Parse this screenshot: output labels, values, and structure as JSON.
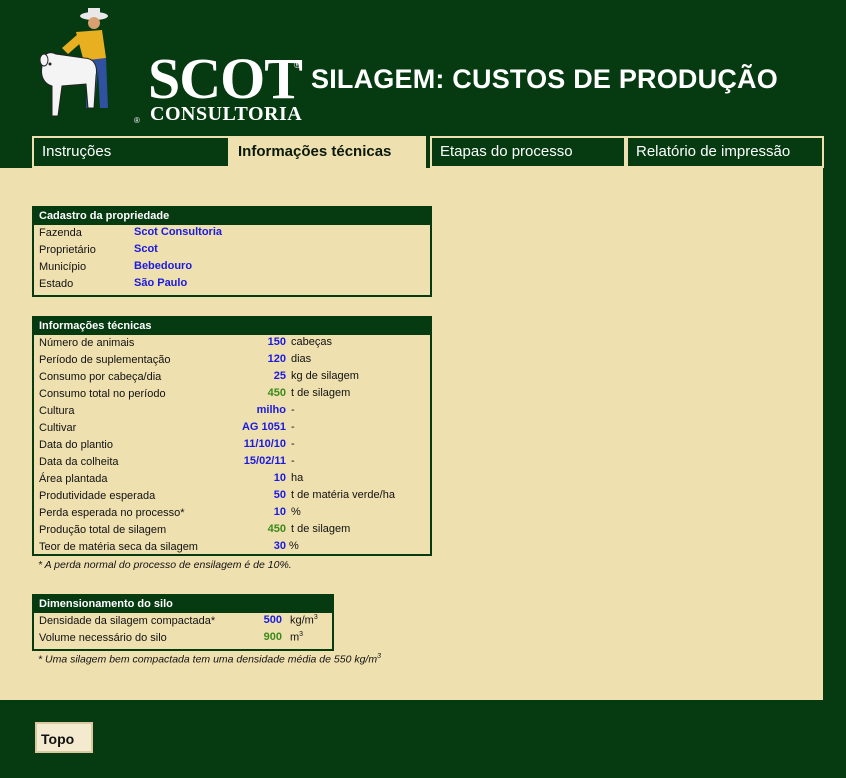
{
  "header": {
    "logo_word": "SCOT",
    "logo_sub": "CONSULTORIA",
    "logo_reg": "®",
    "title": "SILAGEM: CUSTOS DE PRODUÇÃO"
  },
  "tabs": [
    {
      "label": "Instruções",
      "active": false
    },
    {
      "label": "Informações técnicas",
      "active": true
    },
    {
      "label": "Etapas do processo",
      "active": false
    },
    {
      "label": "Relatório de impressão",
      "active": false
    }
  ],
  "cadastro": {
    "title": "Cadastro da propriedade",
    "rows": [
      {
        "label": "Fazenda",
        "value": "Scot Consultoria"
      },
      {
        "label": "Proprietário",
        "value": "Scot"
      },
      {
        "label": "Município",
        "value": "Bebedouro"
      },
      {
        "label": "Estado",
        "value": "São Paulo"
      }
    ]
  },
  "info": {
    "title": "Informações técnicas",
    "rows": [
      {
        "label": "Número de animais",
        "value": "150",
        "unit": "cabeças",
        "color": "blue"
      },
      {
        "label": "Período de suplementação",
        "value": "120",
        "unit": "dias",
        "color": "blue"
      },
      {
        "label": "Consumo por cabeça/dia",
        "value": "25",
        "unit": "kg de silagem",
        "color": "blue"
      },
      {
        "label": "Consumo total no período",
        "value": "450",
        "unit": "t de silagem",
        "color": "green"
      },
      {
        "label": "Cultura",
        "value": "milho",
        "unit": "-",
        "color": "blue"
      },
      {
        "label": "Cultivar",
        "value": "AG 1051",
        "unit": "-",
        "color": "blue"
      },
      {
        "label": "Data do plantio",
        "value": "11/10/10",
        "unit": "-",
        "color": "blue"
      },
      {
        "label": "Data da colheita",
        "value": "15/02/11",
        "unit": "-",
        "color": "blue"
      },
      {
        "label": "Área plantada",
        "value": "10",
        "unit": "ha",
        "color": "blue"
      },
      {
        "label": "Produtividade esperada",
        "value": "50",
        "unit": "t de matéria verde/ha",
        "color": "blue"
      },
      {
        "label": "Perda esperada no processo*",
        "value": "10",
        "unit": "%",
        "color": "blue"
      },
      {
        "label": "Produção total de silagem",
        "value": "450",
        "unit": "t de silagem",
        "color": "green"
      },
      {
        "label": "Teor de matéria seca da silagem",
        "value": "30",
        "unit": "%",
        "color": "blue"
      }
    ],
    "note": "* A perda normal do processo de ensilagem é de 10%."
  },
  "silo": {
    "title": "Dimensionamento do silo",
    "rows": [
      {
        "label": "Densidade da silagem compactada*",
        "value": "500",
        "unit": "kg/m",
        "sup": "3",
        "color": "blue"
      },
      {
        "label": "Volume necessário do silo",
        "value": "900",
        "unit": "m",
        "sup": "3",
        "color": "green"
      }
    ],
    "note": "* Uma silagem bem compactada tem uma densidade média de 550 kg/m",
    "note_sup": "3"
  },
  "footer": {
    "top_button": "Topo"
  },
  "colors": {
    "dark_green": "#063b12",
    "beige": "#efe0b0",
    "blue": "#1a1ae0",
    "green": "#3b8a1a"
  }
}
